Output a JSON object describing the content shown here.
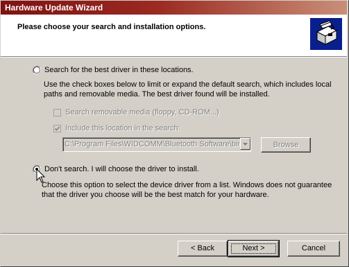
{
  "window": {
    "title": "Hardware Update Wizard"
  },
  "header": {
    "heading": "Please choose your search and installation options.",
    "logo_icon": "hardware-wizard-icon"
  },
  "option_search": {
    "label": "Search for the best driver in these locations.",
    "description": "Use the check boxes below to limit or expand the default search, which includes local paths and removable media. The best driver found will be installed.",
    "selected": false
  },
  "check_removable": {
    "label": "Search removable media (floppy, CD-ROM...)",
    "checked": false,
    "enabled": false
  },
  "check_include": {
    "label": "Include this location in the search:",
    "checked": true,
    "enabled": false
  },
  "location": {
    "value": "C:\\Program Files\\WIDCOMM\\Bluetooth Software\\bin",
    "browse_label": "Browse"
  },
  "option_dont_search": {
    "label": "Don't search. I will choose the driver to install.",
    "description": "Choose this option to select the device driver from a list.  Windows does not guarantee that the driver you choose will be the best match for your hardware.",
    "selected": true
  },
  "buttons": {
    "back": "< Back",
    "next": "Next >",
    "cancel": "Cancel"
  },
  "colors": {
    "title_start": "#7e1212",
    "title_end": "#c98f78",
    "face": "#d4d0c8",
    "logo_bg": "#0a1f8e"
  }
}
